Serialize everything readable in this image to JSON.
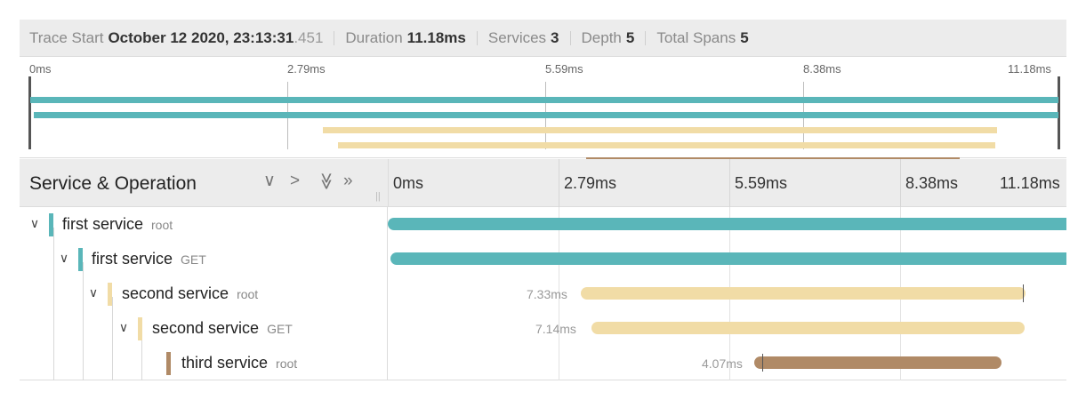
{
  "header": {
    "trace_start_label": "Trace Start",
    "trace_start_value": "October 12 2020, 23:13:31",
    "trace_start_ms": ".451",
    "duration_label": "Duration",
    "duration_value": "11.18ms",
    "services_label": "Services",
    "services_value": "3",
    "depth_label": "Depth",
    "depth_value": "5",
    "spans_label": "Total Spans",
    "spans_value": "5"
  },
  "minimap": {
    "ticks": [
      "0ms",
      "2.79ms",
      "5.59ms",
      "8.38ms",
      "11.18ms"
    ]
  },
  "timeline": {
    "column_title": "Service & Operation",
    "controls": {
      "collapse_one": "∨",
      "expand_one": ">",
      "collapse_all": "≫",
      "expand_all": "»"
    },
    "ticks": [
      "0ms",
      "2.79ms",
      "5.59ms",
      "8.38ms",
      "11.18ms"
    ]
  },
  "colors": {
    "first_service": "#5ab6b9",
    "second_service": "#f1dca6",
    "third_service": "#b08a66"
  },
  "spans": [
    {
      "service": "first service",
      "operation": "root",
      "depth": 0,
      "duration_label": "",
      "start_ms": 0.0,
      "end_ms": 11.18,
      "color": "#5ab6b9"
    },
    {
      "service": "first service",
      "operation": "GET",
      "depth": 1,
      "duration_label": "",
      "start_ms": 0.04,
      "end_ms": 11.18,
      "color": "#5ab6b9"
    },
    {
      "service": "second service",
      "operation": "root",
      "depth": 2,
      "duration_label": "7.33ms",
      "start_ms": 3.18,
      "end_ms": 10.51,
      "color": "#f1dca6"
    },
    {
      "service": "second service",
      "operation": "GET",
      "depth": 3,
      "duration_label": "7.14ms",
      "start_ms": 3.35,
      "end_ms": 10.49,
      "color": "#f1dca6"
    },
    {
      "service": "third service",
      "operation": "root",
      "depth": 4,
      "duration_label": "4.07ms",
      "start_ms": 6.04,
      "end_ms": 10.11,
      "color": "#b08a66"
    }
  ]
}
